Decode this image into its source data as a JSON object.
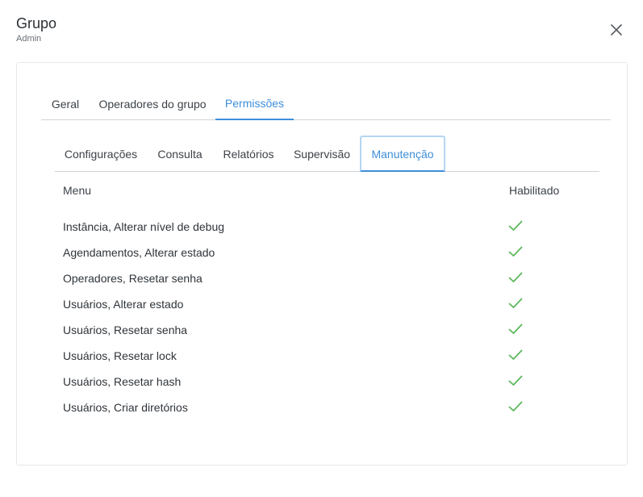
{
  "header": {
    "title": "Grupo",
    "subtitle": "Admin"
  },
  "main_tabs": [
    {
      "label": "Geral",
      "active": false
    },
    {
      "label": "Operadores do grupo",
      "active": false
    },
    {
      "label": "Permissões",
      "active": true
    }
  ],
  "sub_tabs": [
    {
      "label": "Configurações",
      "active": false
    },
    {
      "label": "Consulta",
      "active": false
    },
    {
      "label": "Relatórios",
      "active": false
    },
    {
      "label": "Supervisão",
      "active": false
    },
    {
      "label": "Manutenção",
      "active": true
    }
  ],
  "table": {
    "headers": {
      "menu": "Menu",
      "enabled": "Habilitado"
    },
    "rows": [
      {
        "menu": "Instância, Alterar nível de debug",
        "enabled": true
      },
      {
        "menu": "Agendamentos, Alterar estado",
        "enabled": true
      },
      {
        "menu": "Operadores, Resetar senha",
        "enabled": true
      },
      {
        "menu": "Usuários, Alterar estado",
        "enabled": true
      },
      {
        "menu": "Usuários, Resetar senha",
        "enabled": true
      },
      {
        "menu": "Usuários, Resetar lock",
        "enabled": true
      },
      {
        "menu": "Usuários, Resetar hash",
        "enabled": true
      },
      {
        "menu": "Usuários, Criar diretórios",
        "enabled": true
      }
    ]
  },
  "colors": {
    "accent": "#3f8ed9",
    "check": "#5cb85c",
    "border": "#cfd3d7"
  },
  "icons": {
    "close": "close-icon",
    "check": "check-icon"
  }
}
